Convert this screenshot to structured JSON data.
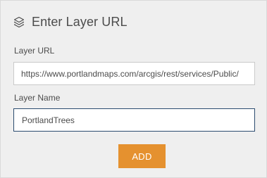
{
  "header": {
    "icon": "layers-icon",
    "title": "Enter Layer URL"
  },
  "form": {
    "url_label": "Layer URL",
    "url_value": "https://www.portlandmaps.com/arcgis/rest/services/Public/",
    "name_label": "Layer Name",
    "name_value": "PortlandTrees"
  },
  "actions": {
    "add_label": "ADD"
  },
  "colors": {
    "panel_background": "#efefef",
    "accent_button": "#e5912f",
    "focused_input_border": "#2b4b6f",
    "text": "#4c4c4c"
  }
}
